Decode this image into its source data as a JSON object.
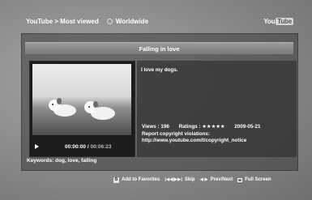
{
  "header": {
    "breadcrumb": "YouTube > Most viewed",
    "region": "Worldwide",
    "logo_you": "You",
    "logo_tube": "Tube"
  },
  "video": {
    "title": "Falling in love",
    "description": "I love my dogs.",
    "time_current": "00:00:00",
    "time_separator": " / ",
    "time_total": "00:06:23",
    "views_label": "Views : 196",
    "ratings_label": "Ratings :",
    "rating_stars": "★★★★★",
    "date": "2009-05-21",
    "report_label": "Report copyright violations:",
    "report_url": "http://www.youtube.com/t/copyright_notice",
    "keywords": "Keywords: dog, love, falling"
  },
  "footer": {
    "favorites_key": "B",
    "favorites_label": "Add to Favorites",
    "skip_glyph": "|◀◀|▶▶|",
    "skip_label": "Skip",
    "prevnext_glyph": "◀ ▶",
    "prevnext_label": "Prev/Next",
    "fullscreen_label": "Full Screen"
  },
  "colors": {
    "background": "#8d8d8d",
    "panel": "#3c3c3c",
    "title_bar": "#8a8a8a",
    "text": "#ffffff"
  }
}
